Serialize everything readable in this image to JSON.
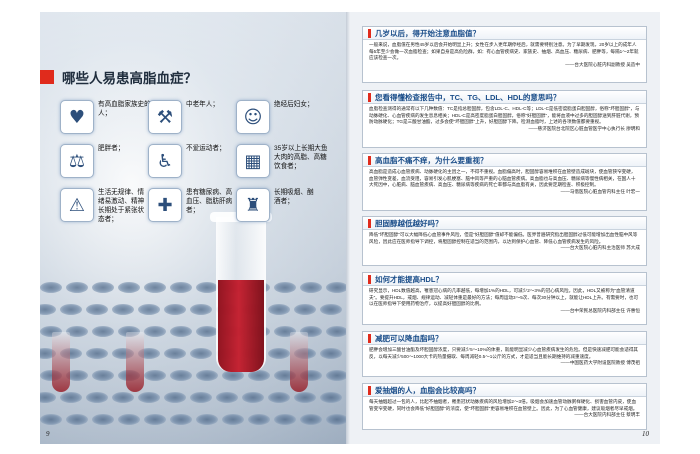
{
  "left_page": {
    "title": "哪些人易患高脂血症？",
    "page_number": "9",
    "risk_groups": [
      {
        "icon": "heart-icon",
        "glyph": "♥",
        "label": "有高血脂家族史的人；"
      },
      {
        "icon": "worker-icon",
        "glyph": "⚒",
        "label": "中老年人；"
      },
      {
        "icon": "woman-icon",
        "glyph": "☺",
        "label": "绝经后妇女；"
      },
      {
        "icon": "scale-icon",
        "glyph": "⚖",
        "label": "肥胖者；"
      },
      {
        "icon": "sitting-icon",
        "glyph": "♿",
        "label": "不爱运动者；"
      },
      {
        "icon": "calendar-icon",
        "glyph": "▦",
        "label": "35岁以上长期大鱼大肉的高脂、高糖饮食者；"
      },
      {
        "icon": "lifestyle-icon",
        "glyph": "⚠",
        "label": "生活无规律、情绪易激动、精神长期处于紧张状态者；"
      },
      {
        "icon": "hospital-icon",
        "glyph": "✚",
        "label": "患有糖尿病、高血压、脂肪肝病者；"
      },
      {
        "icon": "bottles-icon",
        "glyph": "♜",
        "label": "长期吸烟、酗酒者；"
      }
    ]
  },
  "right_page": {
    "page_number": "10",
    "sections": [
      {
        "heading": "几岁以后，得开始注意血脂值？",
        "body": "一般来说，血脂值在男性45岁以后会开始明显上升；女性在步入更年期停经后，就需要特别注意。为了早期发现，20岁以上的成年人每5年至少会做一次血脂检查；如果自身是高危险群，如：有心血管疾病史、家族史、抽烟、高血压、糖尿病、肥胖等，每隔1～2年就应该检查一次。",
        "source": "——台大医院心脏内科副教授 吴造中"
      },
      {
        "heading": "您看得懂检查报告中，TC、TG、LDL、HDL的意思吗？",
        "body": "血脂检查测得的通常有以下几种数值：TC是指总胆固醇，包含LDL-C、HDL-C等；LDL-C是低密度脂蛋白胆固醇，俗称\"坏胆固醇\"，与动脉硬化、心血管疾病的发生息息相关；HDL-C是高密度脂蛋白胆固醇，俗称\"好胆固醇\"，能将血液中过多的胆固醇送到肝脏代谢，预防动脉硬化；TG是三酸甘油酯，过多会使\"坏胆固醇\"上升，好胆固醇下降。检测血脂时，上述的各项数值都要重视。",
        "source": "——慈济医院台北院区心脏血管医学中心执行长 廖明和"
      },
      {
        "heading": "高血脂不痛不痒，为什么要重视？",
        "body": "高血脂是造成心血管疾病、动脉硬化的主因之一，不得不重视。血脂偏高时，胆固醇容易堆积在血管壁造成斑块，使血管狭窄变硬，血管弹性变差，血流受阻，容易引发心肌梗塞、脑中风等严重的心脑血管疾病。高血脂也与高血压、糖尿病等慢性病相关，在国人十大死因中，心脏病、脑血管疾病、高血压、糖尿病等疾病的死亡率都与高血脂有关，因此要定期检查、积极控制。",
        "source": "——马偕医院心脏血管内科主任 叶宏一"
      },
      {
        "heading": "胆固醇越低越好吗？",
        "body": "降低\"坏胆固醇\"可以大幅降低心血管事件风险，但是\"好胆固醇\"值却不能偏低。医界普遍研究指出胆固醇过低可能增加出血性脑中风等风险，因此应在医师指导下调控，将胆固醇控制在适当的范围内，以达到保护心血管、降低心血管疾病发生的风险。",
        "source": "——台大医院心脏内科主治医师 苏大成"
      },
      {
        "heading": "如何才能提高HDL？",
        "body": "研究显示，HDL数值越高，罹患冠心病的几率越低，每增加1%的HDL，可减少2～3%的冠心病风险。因此，HDL又被称为\"血管清道夫\"。要提升HDL，戒烟、规律运动、减轻体重是最好的方法；每周运动3～5次、每次30分钟以上，就能让HDL上升。有需要时，也可以在医师指导下使用药物治疗，以提高好胆固醇的比例。",
        "source": "——台中荣民总医院内科部主任 许惠恒"
      },
      {
        "heading": "减肥可以降血脂吗？",
        "body": "肥胖会增加三酸甘油酯及坏胆固醇浓度，只要减少5～10%的体重，就能明显减少心血管疾病发生的危险。但是快速减肥可能会适得其反，以每天减少500～1000大卡的热量摄取、每周减轻0.5～1公斤的方式，才是适当且能长期维持的减重速度。",
        "source": "——中国医药大学附设医院教授 傅茂祖"
      },
      {
        "heading": "爱抽烟的人，血脂会比较高吗？",
        "body": "每天抽烟超过一包的人，比起不抽烟者，罹患冠状动脉疾病的风险增加2～3倍。吸烟会加速血管动脉粥样硬化、损害血管内皮，使血管变窄变硬，同时也会降低\"好胆固醇\"的浓度，使\"坏胆固醇\"更容易堆积在血管壁上。因此，为了心血管健康，建议吸烟者尽早戒烟。",
        "source": "——台大医院内科部主任 蔡明丰"
      }
    ]
  }
}
